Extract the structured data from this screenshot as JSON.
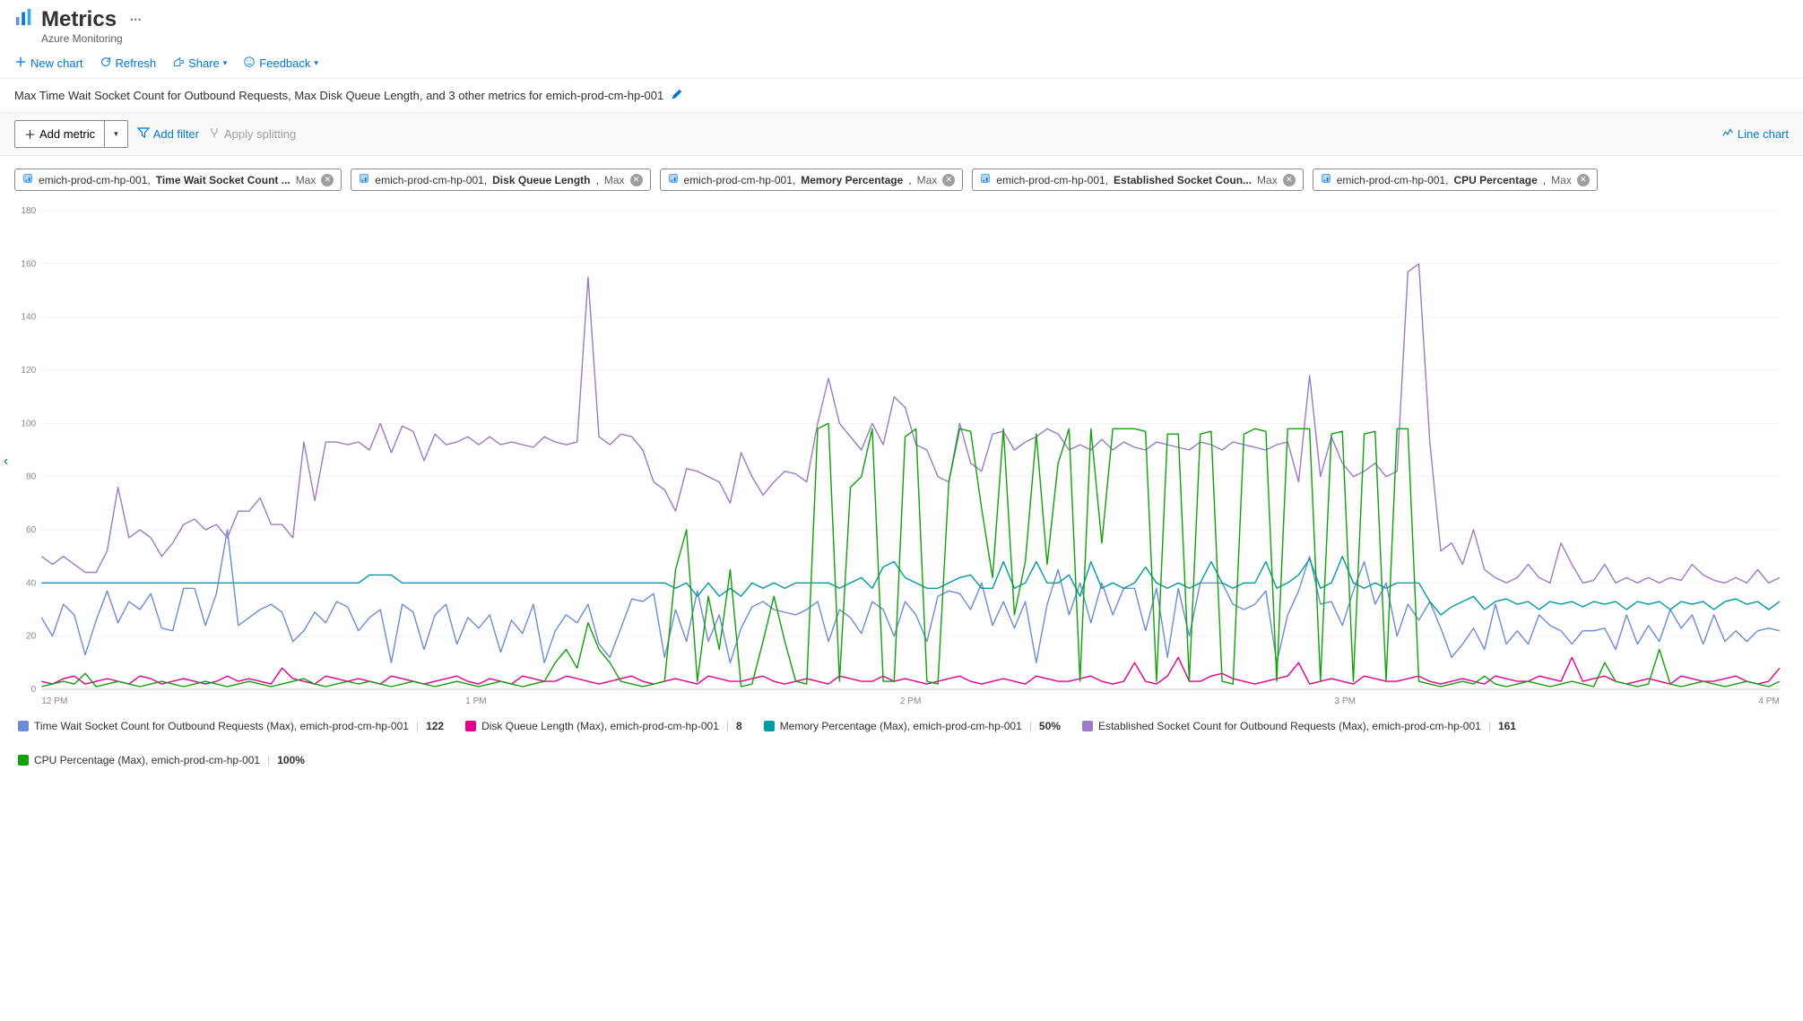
{
  "header": {
    "title": "Metrics",
    "subtitle": "Azure Monitoring"
  },
  "toolbar": {
    "new_chart": "New chart",
    "refresh": "Refresh",
    "share": "Share",
    "feedback": "Feedback"
  },
  "description": "Max Time Wait Socket Count for Outbound Requests, Max Disk Queue Length, and 3 other metrics for emich-prod-cm-hp-001",
  "metric_bar": {
    "add_metric": "Add metric",
    "add_filter": "Add filter",
    "apply_splitting": "Apply splitting",
    "chart_type": "Line chart"
  },
  "chips": [
    {
      "resource": "emich-prod-cm-hp-001",
      "metric": "Time Wait Socket Count ...",
      "agg": "Max"
    },
    {
      "resource": "emich-prod-cm-hp-001",
      "metric": "Disk Queue Length",
      "agg": "Max"
    },
    {
      "resource": "emich-prod-cm-hp-001",
      "metric": "Memory Percentage",
      "agg": "Max"
    },
    {
      "resource": "emich-prod-cm-hp-001",
      "metric": "Established Socket Coun...",
      "agg": "Max"
    },
    {
      "resource": "emich-prod-cm-hp-001",
      "metric": "CPU Percentage",
      "agg": "Max"
    }
  ],
  "legend": [
    {
      "color": "#6c8cd5",
      "label": "Time Wait Socket Count for Outbound Requests (Max), emich-prod-cm-hp-001",
      "value": "122"
    },
    {
      "color": "#e3008c",
      "label": "Disk Queue Length (Max), emich-prod-cm-hp-001",
      "value": "8"
    },
    {
      "color": "#009aa2",
      "label": "Memory Percentage (Max), emich-prod-cm-hp-001",
      "value": "50%"
    },
    {
      "color": "#9b7bc7",
      "label": "Established Socket Count for Outbound Requests (Max), emich-prod-cm-hp-001",
      "value": "161"
    },
    {
      "color": "#12a00d",
      "label": "CPU Percentage (Max), emich-prod-cm-hp-001",
      "value": "100%"
    }
  ],
  "chart_data": {
    "type": "line",
    "xlabel": "",
    "ylabel": "",
    "ylim": [
      0,
      180
    ],
    "y_ticks": [
      0,
      20,
      40,
      60,
      80,
      100,
      120,
      140,
      160,
      180
    ],
    "x_ticks": [
      "12 PM",
      "1 PM",
      "2 PM",
      "3 PM",
      "4 PM"
    ],
    "series": [
      {
        "name": "Time Wait Socket Count for Outbound Requests (Max)",
        "color": "#6c8cd5",
        "values": [
          27,
          20,
          32,
          28,
          13,
          26,
          37,
          25,
          33,
          30,
          36,
          23,
          22,
          38,
          38,
          24,
          36,
          60,
          24,
          27,
          30,
          32,
          29,
          18,
          22,
          29,
          25,
          33,
          31,
          22,
          27,
          30,
          10,
          32,
          29,
          15,
          28,
          32,
          17,
          27,
          23,
          28,
          14,
          26,
          21,
          32,
          10,
          22,
          28,
          25,
          32,
          17,
          12,
          23,
          34,
          33,
          36,
          12,
          30,
          18,
          37,
          18,
          28,
          10,
          23,
          31,
          33,
          30,
          29,
          28,
          30,
          33,
          18,
          30,
          27,
          21,
          33,
          30,
          20,
          33,
          28,
          18,
          35,
          37,
          36,
          30,
          40,
          24,
          33,
          23,
          33,
          10,
          32,
          45,
          28,
          40,
          25,
          40,
          28,
          38,
          38,
          22,
          38,
          12,
          38,
          20,
          40,
          40,
          40,
          32,
          30,
          32,
          37,
          10,
          28,
          37,
          50,
          32,
          33,
          24,
          37,
          48,
          32,
          40,
          20,
          32,
          26,
          33,
          23,
          12,
          17,
          23,
          15,
          32,
          17,
          22,
          17,
          28,
          24,
          22,
          17,
          22,
          22,
          23,
          15,
          28,
          17,
          24,
          18,
          30,
          23,
          28,
          17,
          28,
          18,
          22,
          18,
          22,
          23,
          22
        ]
      },
      {
        "name": "Disk Queue Length (Max)",
        "color": "#e3008c",
        "values": [
          3,
          2,
          4,
          5,
          2,
          3,
          4,
          3,
          2,
          5,
          4,
          2,
          3,
          4,
          3,
          2,
          3,
          5,
          3,
          4,
          3,
          2,
          8,
          4,
          3,
          2,
          5,
          4,
          3,
          4,
          3,
          2,
          5,
          4,
          3,
          2,
          3,
          4,
          5,
          3,
          2,
          4,
          3,
          2,
          5,
          4,
          3,
          3,
          5,
          4,
          3,
          2,
          3,
          4,
          5,
          3,
          2,
          3,
          4,
          3,
          2,
          5,
          4,
          3,
          3,
          4,
          5,
          3,
          2,
          3,
          4,
          3,
          2,
          5,
          4,
          3,
          3,
          5,
          3,
          4,
          3,
          2,
          3,
          4,
          5,
          3,
          2,
          3,
          4,
          3,
          2,
          5,
          4,
          3,
          3,
          4,
          5,
          3,
          2,
          3,
          10,
          3,
          2,
          5,
          12,
          3,
          3,
          5,
          6,
          4,
          3,
          2,
          3,
          4,
          5,
          10,
          2,
          3,
          4,
          3,
          2,
          5,
          4,
          3,
          3,
          4,
          5,
          3,
          2,
          3,
          4,
          3,
          2,
          5,
          4,
          3,
          3,
          5,
          4,
          3,
          12,
          3,
          4,
          5,
          3,
          2,
          3,
          4,
          3,
          2,
          5,
          4,
          3,
          3,
          4,
          5,
          3,
          2,
          3,
          8
        ]
      },
      {
        "name": "Memory Percentage (Max)",
        "color": "#009aa2",
        "values": [
          40,
          40,
          40,
          40,
          40,
          40,
          40,
          40,
          40,
          40,
          40,
          40,
          40,
          40,
          40,
          40,
          40,
          40,
          40,
          40,
          40,
          40,
          40,
          40,
          40,
          40,
          40,
          40,
          40,
          40,
          43,
          43,
          43,
          40,
          40,
          40,
          40,
          40,
          40,
          40,
          40,
          40,
          40,
          40,
          40,
          40,
          40,
          40,
          40,
          40,
          40,
          40,
          40,
          40,
          40,
          40,
          40,
          40,
          38,
          40,
          35,
          40,
          35,
          38,
          35,
          40,
          38,
          40,
          38,
          40,
          40,
          40,
          40,
          38,
          40,
          42,
          38,
          46,
          48,
          42,
          40,
          38,
          38,
          40,
          42,
          43,
          38,
          38,
          48,
          38,
          40,
          48,
          40,
          40,
          43,
          35,
          48,
          38,
          40,
          38,
          40,
          46,
          40,
          38,
          40,
          38,
          40,
          48,
          40,
          38,
          40,
          40,
          48,
          38,
          40,
          43,
          49,
          38,
          40,
          50,
          40,
          38,
          40,
          38,
          40,
          40,
          40,
          33,
          28,
          31,
          33,
          35,
          30,
          33,
          34,
          32,
          33,
          30,
          33,
          32,
          33,
          31,
          33,
          32,
          33,
          30,
          33,
          32,
          33,
          30,
          33,
          32,
          33,
          30,
          33,
          34,
          32,
          33,
          30,
          33
        ]
      },
      {
        "name": "Established Socket Count for Outbound Requests (Max)",
        "color": "#9b7bc7",
        "values": [
          50,
          47,
          50,
          47,
          44,
          44,
          52,
          76,
          57,
          60,
          57,
          50,
          55,
          62,
          64,
          60,
          62,
          57,
          67,
          67,
          72,
          62,
          62,
          57,
          93,
          71,
          93,
          93,
          92,
          93,
          90,
          100,
          89,
          99,
          97,
          86,
          96,
          92,
          93,
          95,
          92,
          95,
          92,
          93,
          92,
          91,
          95,
          93,
          92,
          93,
          155,
          95,
          92,
          96,
          95,
          90,
          78,
          75,
          67,
          83,
          82,
          80,
          78,
          70,
          89,
          80,
          73,
          78,
          82,
          81,
          78,
          100,
          117,
          100,
          95,
          90,
          100,
          92,
          110,
          106,
          92,
          90,
          80,
          78,
          100,
          85,
          82,
          96,
          97,
          90,
          93,
          95,
          98,
          96,
          90,
          92,
          90,
          94,
          90,
          93,
          91,
          90,
          93,
          92,
          91,
          90,
          93,
          92,
          90,
          93,
          92,
          91,
          90,
          92,
          93,
          78,
          118,
          80,
          95,
          85,
          80,
          82,
          85,
          80,
          82,
          157,
          160,
          93,
          52,
          55,
          47,
          60,
          45,
          42,
          40,
          42,
          47,
          42,
          40,
          55,
          47,
          40,
          41,
          47,
          40,
          42,
          40,
          42,
          40,
          42,
          41,
          47,
          43,
          41,
          40,
          42,
          40,
          45,
          40,
          42
        ]
      },
      {
        "name": "CPU Percentage (Max)",
        "color": "#12a00d",
        "values": [
          1,
          2,
          3,
          2,
          6,
          1,
          2,
          3,
          2,
          1,
          2,
          3,
          2,
          1,
          2,
          3,
          2,
          1,
          2,
          3,
          2,
          1,
          2,
          3,
          4,
          2,
          1,
          2,
          3,
          2,
          3,
          2,
          1,
          2,
          3,
          2,
          1,
          2,
          3,
          2,
          1,
          2,
          3,
          2,
          1,
          2,
          3,
          10,
          15,
          8,
          25,
          15,
          10,
          3,
          2,
          1,
          2,
          3,
          45,
          60,
          3,
          35,
          15,
          45,
          1,
          2,
          18,
          35,
          18,
          3,
          2,
          98,
          100,
          3,
          76,
          80,
          98,
          3,
          3,
          95,
          98,
          3,
          2,
          78,
          98,
          97,
          68,
          42,
          98,
          28,
          48,
          96,
          47,
          85,
          98,
          3,
          98,
          55,
          98,
          98,
          98,
          97,
          3,
          96,
          96,
          3,
          96,
          97,
          3,
          2,
          96,
          98,
          97,
          3,
          98,
          98,
          98,
          3,
          96,
          97,
          3,
          96,
          97,
          3,
          98,
          98,
          3,
          2,
          1,
          2,
          3,
          2,
          5,
          2,
          1,
          2,
          3,
          2,
          1,
          2,
          3,
          2,
          1,
          10,
          3,
          2,
          1,
          2,
          15,
          2,
          1,
          2,
          3,
          2,
          1,
          2,
          3,
          2,
          1,
          3
        ]
      }
    ]
  }
}
